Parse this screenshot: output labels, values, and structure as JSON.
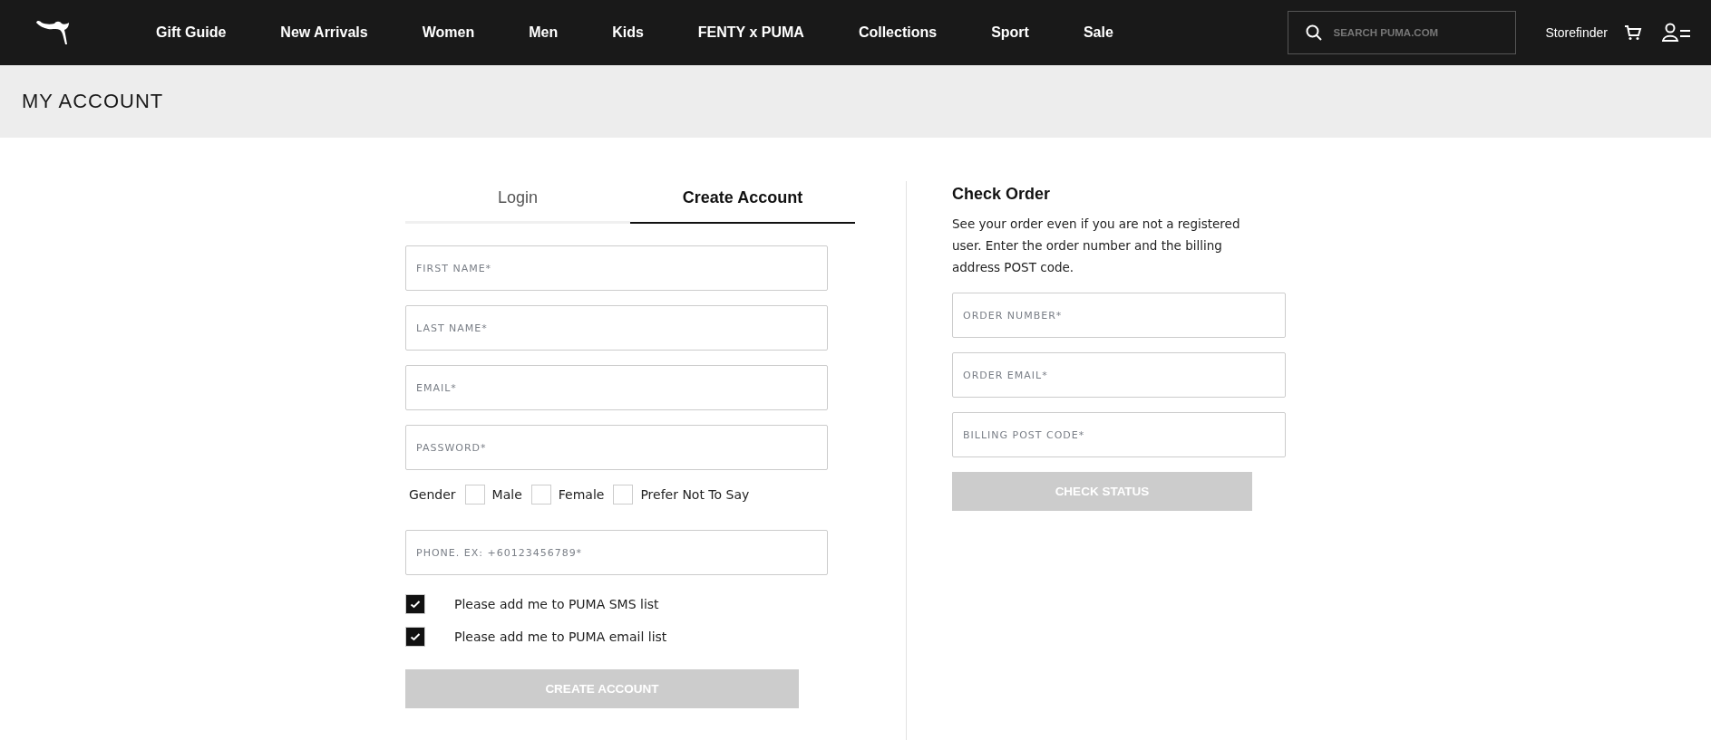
{
  "nav": {
    "items": [
      "Gift Guide",
      "New Arrivals",
      "Women",
      "Men",
      "Kids",
      "FENTY x PUMA",
      "Collections",
      "Sport",
      "Sale"
    ],
    "search": {
      "placeholder": "SEARCH PUMA.COM"
    },
    "storefinder": "Storefinder"
  },
  "page_title": "MY ACCOUNT",
  "tabs": [
    {
      "label": "Login",
      "selected": false
    },
    {
      "label": "Create Account",
      "selected": true
    }
  ],
  "create_form": {
    "fields": [
      {
        "placeholder": "FIRST NAME*"
      },
      {
        "placeholder": "LAST NAME*"
      },
      {
        "placeholder": "EMAIL*"
      },
      {
        "placeholder": "PASSWORD*"
      }
    ],
    "gender": {
      "label": "Gender",
      "options": [
        {
          "label": "Male",
          "checked": false
        },
        {
          "label": "Female",
          "checked": false
        },
        {
          "label": "Prefer Not To Say",
          "checked": false
        }
      ]
    },
    "phone": {
      "placeholder": "PHONE. EX: +60123456789*"
    },
    "opt_ins": [
      {
        "label": "Please add me to PUMA SMS list",
        "checked": true
      },
      {
        "label": "Please add me to PUMA email list",
        "checked": true
      }
    ],
    "submit": {
      "label": "CREATE ACCOUNT",
      "disabled": true
    }
  },
  "check_order": {
    "title": "Check Order",
    "description": "See your order even if you are not a registered user. Enter the order number and the billing address POST code.",
    "fields": [
      {
        "placeholder": "ORDER NUMBER*"
      },
      {
        "placeholder": "ORDER EMAIL*"
      },
      {
        "placeholder": "BILLING POST CODE*"
      }
    ],
    "submit": {
      "label": "CHECK STATUS",
      "disabled": true
    }
  }
}
